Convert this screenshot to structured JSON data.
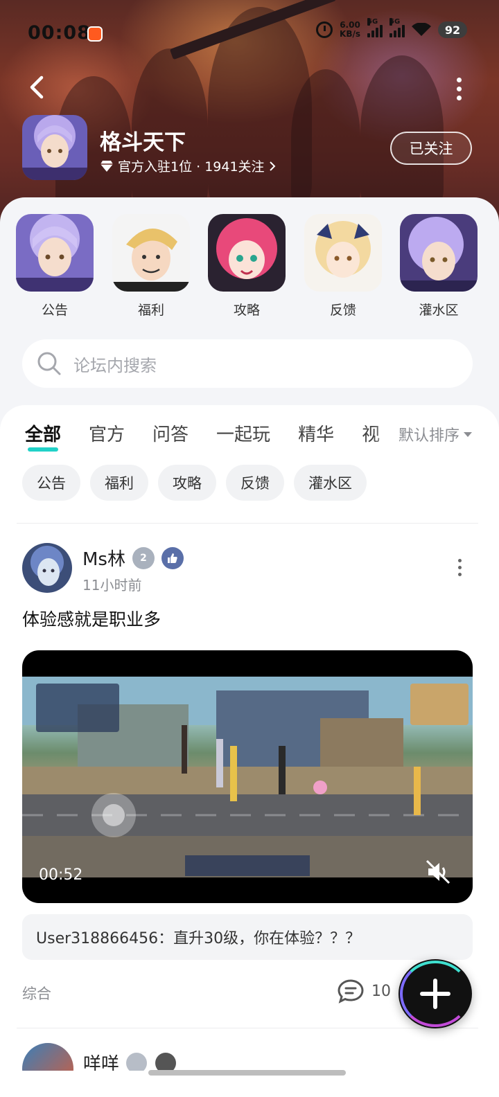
{
  "status_bar": {
    "time": "00:08",
    "net_speed_value": "6.00",
    "net_speed_unit": "KB/s",
    "signal1_label": "5G",
    "signal2_label": "5G",
    "battery": "92"
  },
  "header": {
    "game_name": "格斗天下",
    "meta": "官方入驻1位 · 1941关注",
    "follow_label": "已关注"
  },
  "categories": [
    {
      "label": "公告"
    },
    {
      "label": "福利"
    },
    {
      "label": "攻略"
    },
    {
      "label": "反馈"
    },
    {
      "label": "灌水区"
    }
  ],
  "search": {
    "placeholder": "论坛内搜索"
  },
  "tabs": [
    {
      "label": "全部",
      "active": true
    },
    {
      "label": "官方"
    },
    {
      "label": "问答"
    },
    {
      "label": "一起玩"
    },
    {
      "label": "精华"
    },
    {
      "label": "视"
    }
  ],
  "sort_label": "默认排序",
  "chips": [
    "公告",
    "福利",
    "攻略",
    "反馈",
    "灌水区"
  ],
  "post": {
    "author": "Ms林",
    "level_badge": "2",
    "time": "11小时前",
    "title": "体验感就是职业多",
    "video_duration": "00:52",
    "hot_comment": "User318866456：直升30级，你在体验？？？",
    "tag": "综合",
    "comment_count": "10"
  },
  "next_post": {
    "author": "咩咩"
  },
  "colors": {
    "accent": "#21d1c8",
    "banner": "#6a2d26"
  }
}
